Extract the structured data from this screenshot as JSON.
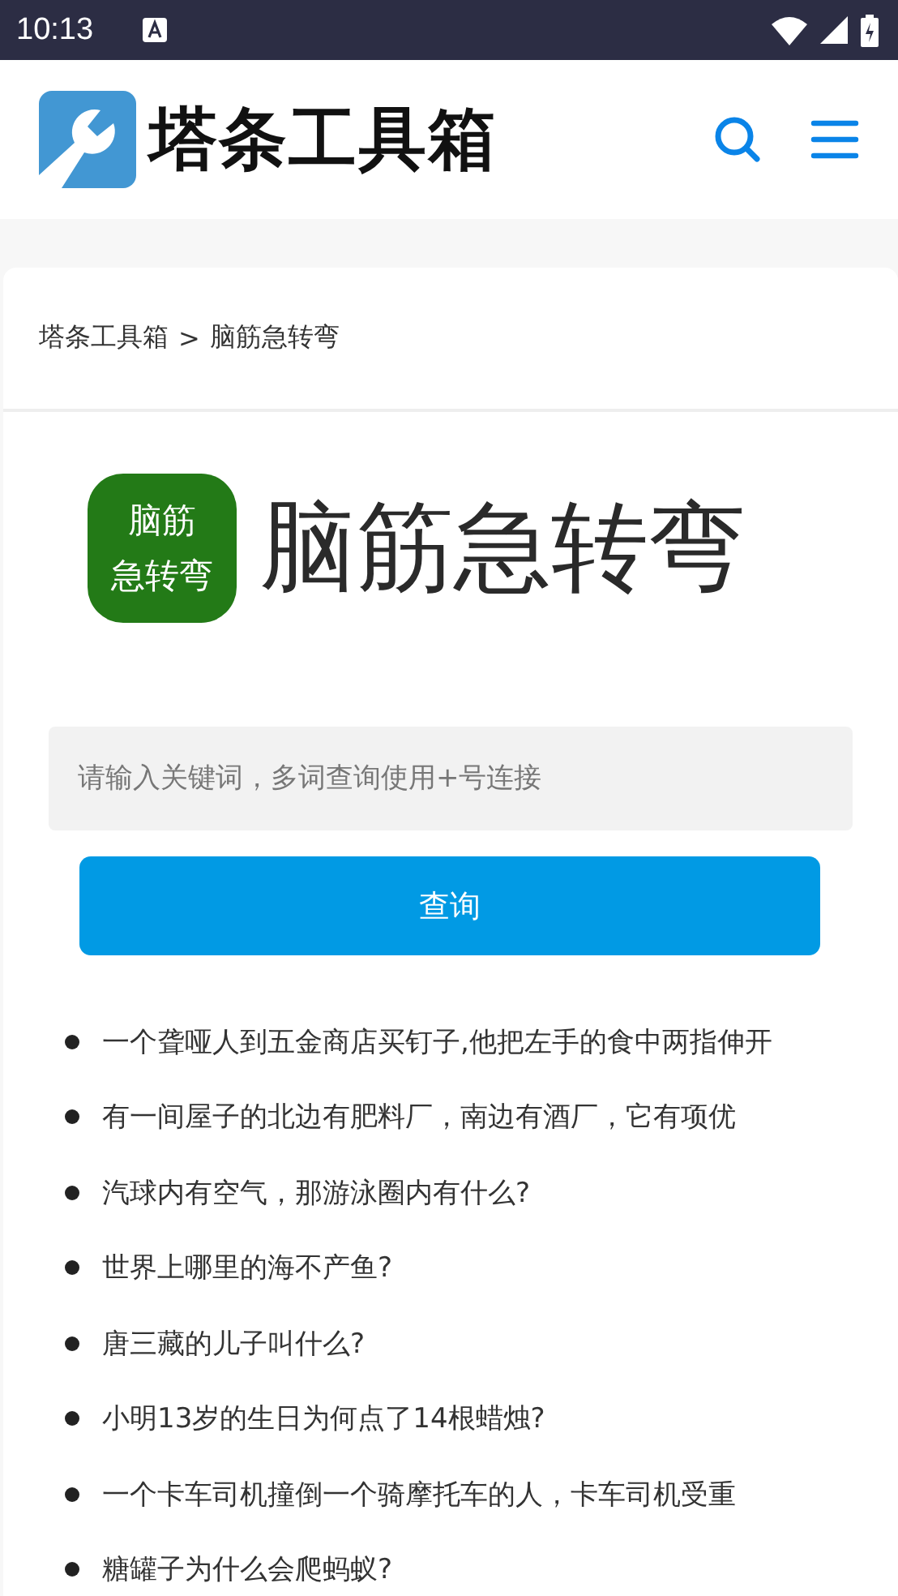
{
  "status_bar": {
    "time": "10:13"
  },
  "header": {
    "logo_text": "塔条工具箱"
  },
  "breadcrumb": {
    "items": [
      "塔条工具箱",
      "脑筋急转弯"
    ],
    "separator": ">"
  },
  "hero": {
    "icon_lines": [
      "脑筋",
      "急转弯"
    ],
    "title": "脑筋急转弯"
  },
  "search": {
    "placeholder": "请输入关键词，多词查询使用+号连接",
    "button": "查询"
  },
  "questions": [
    {
      "text": "一个聋哑人到五金商店买钉子,他把左手的食中两指伸开"
    },
    {
      "text": "有一间屋子的北边有肥料厂，南边有酒厂，它有项优"
    },
    {
      "text": "汽球内有空气，那游泳圈内有什么?"
    },
    {
      "text": "世界上哪里的海不产鱼?"
    },
    {
      "text": "唐三藏的儿子叫什么?"
    },
    {
      "text": "小明13岁的生日为何点了14根蜡烛?"
    },
    {
      "text": "一个卡车司机撞倒一个骑摩托车的人，卡车司机受重"
    },
    {
      "text": "糖罐子为什么会爬蚂蚁?"
    }
  ]
}
